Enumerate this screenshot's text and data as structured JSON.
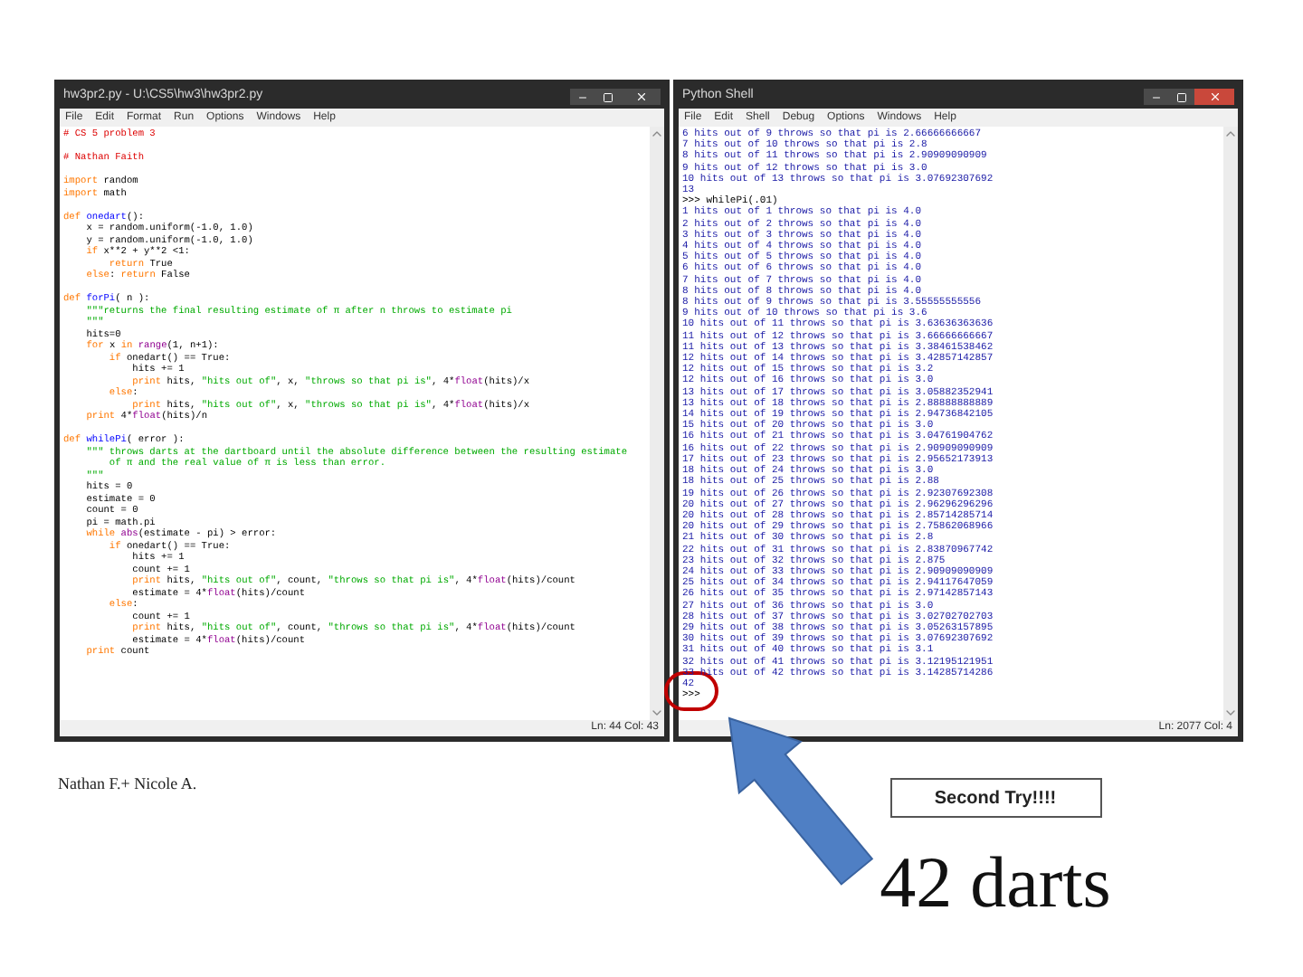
{
  "slide": {
    "editor_window": {
      "title": "hw3pr2.py - U:\\CS5\\hw3\\hw3pr2.py",
      "menu": [
        "File",
        "Edit",
        "Format",
        "Run",
        "Options",
        "Windows",
        "Help"
      ],
      "blocks": [
        {
          "lines": [
            {
              "tokens": [
                {
                  "text": "# CS 5 problem 3",
                  "kind": "comment"
                }
              ]
            }
          ]
        },
        {
          "lines": [
            {
              "tokens": [
                {
                  "text": "# Nathan Faith",
                  "kind": "comment"
                }
              ]
            }
          ]
        },
        {
          "lines": [
            {
              "tokens": [
                {
                  "text": "import",
                  "kind": "keyword"
                },
                {
                  "text": " random",
                  "kind": "plain"
                }
              ]
            },
            {
              "tokens": [
                {
                  "text": "import",
                  "kind": "keyword"
                },
                {
                  "text": " math",
                  "kind": "plain"
                }
              ]
            }
          ]
        },
        {
          "lines": [
            {
              "tokens": [
                {
                  "text": "def ",
                  "kind": "keyword"
                },
                {
                  "text": "onedart",
                  "kind": "defname"
                },
                {
                  "text": "():",
                  "kind": "plain"
                }
              ]
            },
            {
              "tokens": [
                {
                  "text": "    x = random.uniform(-1.0, 1.0)",
                  "kind": "plain"
                }
              ]
            },
            {
              "tokens": [
                {
                  "text": "    y = random.uniform(-1.0, 1.0)",
                  "kind": "plain"
                }
              ]
            },
            {
              "tokens": [
                {
                  "text": "    if",
                  "kind": "keyword"
                },
                {
                  "text": " x**2 + y**2 <1:",
                  "kind": "plain"
                }
              ]
            },
            {
              "tokens": [
                {
                  "text": "        return",
                  "kind": "keyword"
                },
                {
                  "text": " True",
                  "kind": "plain"
                }
              ]
            },
            {
              "tokens": [
                {
                  "text": "    else",
                  "kind": "keyword"
                },
                {
                  "text": ": ",
                  "kind": "plain"
                },
                {
                  "text": "return",
                  "kind": "keyword"
                },
                {
                  "text": " False",
                  "kind": "plain"
                }
              ]
            }
          ]
        },
        {
          "lines": [
            {
              "tokens": [
                {
                  "text": "def ",
                  "kind": "keyword"
                },
                {
                  "text": "forPi",
                  "kind": "defname"
                },
                {
                  "text": "( n ):",
                  "kind": "plain"
                }
              ]
            },
            {
              "tokens": [
                {
                  "text": "    \"\"\"returns the final resulting estimate of π after n throws to estimate pi",
                  "kind": "string"
                }
              ]
            },
            {
              "tokens": [
                {
                  "text": "    \"\"\"",
                  "kind": "string"
                }
              ]
            },
            {
              "tokens": [
                {
                  "text": "    hits=0",
                  "kind": "plain"
                }
              ]
            },
            {
              "tokens": [
                {
                  "text": "    for",
                  "kind": "keyword"
                },
                {
                  "text": " x ",
                  "kind": "plain"
                },
                {
                  "text": "in",
                  "kind": "keyword"
                },
                {
                  "text": " range",
                  "kind": "builtin"
                },
                {
                  "text": "(1, n+1):",
                  "kind": "plain"
                }
              ]
            },
            {
              "tokens": [
                {
                  "text": "        if",
                  "kind": "keyword"
                },
                {
                  "text": " onedart() == True:",
                  "kind": "plain"
                }
              ]
            },
            {
              "tokens": [
                {
                  "text": "            hits += 1",
                  "kind": "plain"
                }
              ]
            },
            {
              "tokens": [
                {
                  "text": "            print",
                  "kind": "keyword"
                },
                {
                  "text": " hits, ",
                  "kind": "plain"
                },
                {
                  "text": "\"hits out of\"",
                  "kind": "string"
                },
                {
                  "text": ", x, ",
                  "kind": "plain"
                },
                {
                  "text": "\"throws so that pi is\"",
                  "kind": "string"
                },
                {
                  "text": ", 4*",
                  "kind": "plain"
                },
                {
                  "text": "float",
                  "kind": "builtin"
                },
                {
                  "text": "(hits)/x",
                  "kind": "plain"
                }
              ]
            },
            {
              "tokens": [
                {
                  "text": "        else",
                  "kind": "keyword"
                },
                {
                  "text": ":",
                  "kind": "plain"
                }
              ]
            },
            {
              "tokens": [
                {
                  "text": "            print",
                  "kind": "keyword"
                },
                {
                  "text": " hits, ",
                  "kind": "plain"
                },
                {
                  "text": "\"hits out of\"",
                  "kind": "string"
                },
                {
                  "text": ", x, ",
                  "kind": "plain"
                },
                {
                  "text": "\"throws so that pi is\"",
                  "kind": "string"
                },
                {
                  "text": ", 4*",
                  "kind": "plain"
                },
                {
                  "text": "float",
                  "kind": "builtin"
                },
                {
                  "text": "(hits)/x",
                  "kind": "plain"
                }
              ]
            },
            {
              "tokens": [
                {
                  "text": "    print",
                  "kind": "keyword"
                },
                {
                  "text": " 4*",
                  "kind": "plain"
                },
                {
                  "text": "float",
                  "kind": "builtin"
                },
                {
                  "text": "(hits)/n",
                  "kind": "plain"
                }
              ]
            }
          ]
        },
        {
          "lines": [
            {
              "tokens": [
                {
                  "text": "def ",
                  "kind": "keyword"
                },
                {
                  "text": "whilePi",
                  "kind": "defname"
                },
                {
                  "text": "( error ):",
                  "kind": "plain"
                }
              ]
            },
            {
              "tokens": [
                {
                  "text": "    \"\"\" throws darts at the dartboard until the absolute difference between the resulting estimate",
                  "kind": "string"
                }
              ]
            },
            {
              "tokens": [
                {
                  "text": "        of π and the real value of π is less than error.",
                  "kind": "string"
                }
              ]
            },
            {
              "tokens": [
                {
                  "text": "    \"\"\"",
                  "kind": "string"
                }
              ]
            },
            {
              "tokens": [
                {
                  "text": "    hits = 0",
                  "kind": "plain"
                }
              ]
            },
            {
              "tokens": [
                {
                  "text": "    estimate = 0",
                  "kind": "plain"
                }
              ]
            },
            {
              "tokens": [
                {
                  "text": "    count = 0",
                  "kind": "plain"
                }
              ]
            },
            {
              "tokens": [
                {
                  "text": "    pi = math.pi",
                  "kind": "plain"
                }
              ]
            },
            {
              "tokens": [
                {
                  "text": "    while",
                  "kind": "keyword"
                },
                {
                  "text": " abs",
                  "kind": "builtin"
                },
                {
                  "text": "(estimate - pi) > error:",
                  "kind": "plain"
                }
              ]
            },
            {
              "tokens": [
                {
                  "text": "        if",
                  "kind": "keyword"
                },
                {
                  "text": " onedart() == True:",
                  "kind": "plain"
                }
              ]
            },
            {
              "tokens": [
                {
                  "text": "            hits += 1",
                  "kind": "plain"
                }
              ]
            },
            {
              "tokens": [
                {
                  "text": "            count += 1",
                  "kind": "plain"
                }
              ]
            },
            {
              "tokens": [
                {
                  "text": "            print",
                  "kind": "keyword"
                },
                {
                  "text": " hits, ",
                  "kind": "plain"
                },
                {
                  "text": "\"hits out of\"",
                  "kind": "string"
                },
                {
                  "text": ", count, ",
                  "kind": "plain"
                },
                {
                  "text": "\"throws so that pi is\"",
                  "kind": "string"
                },
                {
                  "text": ", 4*",
                  "kind": "plain"
                },
                {
                  "text": "float",
                  "kind": "builtin"
                },
                {
                  "text": "(hits)/count",
                  "kind": "plain"
                }
              ]
            },
            {
              "tokens": [
                {
                  "text": "            estimate = 4*",
                  "kind": "plain"
                },
                {
                  "text": "float",
                  "kind": "builtin"
                },
                {
                  "text": "(hits)/count",
                  "kind": "plain"
                }
              ]
            },
            {
              "tokens": [
                {
                  "text": "        else",
                  "kind": "keyword"
                },
                {
                  "text": ":",
                  "kind": "plain"
                }
              ]
            },
            {
              "tokens": [
                {
                  "text": "            count += 1",
                  "kind": "plain"
                }
              ]
            },
            {
              "tokens": [
                {
                  "text": "            print",
                  "kind": "keyword"
                },
                {
                  "text": " hits, ",
                  "kind": "plain"
                },
                {
                  "text": "\"hits out of\"",
                  "kind": "string"
                },
                {
                  "text": ", count, ",
                  "kind": "plain"
                },
                {
                  "text": "\"throws so that pi is\"",
                  "kind": "string"
                },
                {
                  "text": ", 4*",
                  "kind": "plain"
                },
                {
                  "text": "float",
                  "kind": "builtin"
                },
                {
                  "text": "(hits)/count",
                  "kind": "plain"
                }
              ]
            },
            {
              "tokens": [
                {
                  "text": "            estimate = 4*",
                  "kind": "plain"
                },
                {
                  "text": "float",
                  "kind": "builtin"
                },
                {
                  "text": "(hits)/count",
                  "kind": "plain"
                }
              ]
            },
            {
              "tokens": [
                {
                  "text": "    print",
                  "kind": "keyword"
                },
                {
                  "text": " count",
                  "kind": "plain"
                }
              ]
            }
          ]
        }
      ],
      "status": "Ln: 44 Col: 43"
    },
    "shell_window": {
      "title": "Python Shell",
      "menu": [
        "File",
        "Edit",
        "Shell",
        "Debug",
        "Options",
        "Windows",
        "Help"
      ],
      "lines": [
        {
          "text": "6 hits out of 9 throws so that pi is 2.66666666667",
          "kind": "output"
        },
        {
          "text": "7 hits out of 10 throws so that pi is 2.8",
          "kind": "output"
        },
        {
          "text": "8 hits out of 11 throws so that pi is 2.90909090909",
          "kind": "output"
        },
        {
          "text": "9 hits out of 12 throws so that pi is 3.0",
          "kind": "output"
        },
        {
          "text": "10 hits out of 13 throws so that pi is 3.07692307692",
          "kind": "output"
        },
        {
          "text": "13",
          "kind": "output"
        },
        {
          "text": ">>> whilePi(.01)",
          "kind": "input"
        },
        {
          "text": "1 hits out of 1 throws so that pi is 4.0",
          "kind": "output"
        },
        {
          "text": "2 hits out of 2 throws so that pi is 4.0",
          "kind": "output"
        },
        {
          "text": "3 hits out of 3 throws so that pi is 4.0",
          "kind": "output"
        },
        {
          "text": "4 hits out of 4 throws so that pi is 4.0",
          "kind": "output"
        },
        {
          "text": "5 hits out of 5 throws so that pi is 4.0",
          "kind": "output"
        },
        {
          "text": "6 hits out of 6 throws so that pi is 4.0",
          "kind": "output"
        },
        {
          "text": "7 hits out of 7 throws so that pi is 4.0",
          "kind": "output"
        },
        {
          "text": "8 hits out of 8 throws so that pi is 4.0",
          "kind": "output"
        },
        {
          "text": "8 hits out of 9 throws so that pi is 3.55555555556",
          "kind": "output"
        },
        {
          "text": "9 hits out of 10 throws so that pi is 3.6",
          "kind": "output"
        },
        {
          "text": "10 hits out of 11 throws so that pi is 3.63636363636",
          "kind": "output"
        },
        {
          "text": "11 hits out of 12 throws so that pi is 3.66666666667",
          "kind": "output"
        },
        {
          "text": "11 hits out of 13 throws so that pi is 3.38461538462",
          "kind": "output"
        },
        {
          "text": "12 hits out of 14 throws so that pi is 3.42857142857",
          "kind": "output"
        },
        {
          "text": "12 hits out of 15 throws so that pi is 3.2",
          "kind": "output"
        },
        {
          "text": "12 hits out of 16 throws so that pi is 3.0",
          "kind": "output"
        },
        {
          "text": "13 hits out of 17 throws so that pi is 3.05882352941",
          "kind": "output"
        },
        {
          "text": "13 hits out of 18 throws so that pi is 2.88888888889",
          "kind": "output"
        },
        {
          "text": "14 hits out of 19 throws so that pi is 2.94736842105",
          "kind": "output"
        },
        {
          "text": "15 hits out of 20 throws so that pi is 3.0",
          "kind": "output"
        },
        {
          "text": "16 hits out of 21 throws so that pi is 3.04761904762",
          "kind": "output"
        },
        {
          "text": "16 hits out of 22 throws so that pi is 2.90909090909",
          "kind": "output"
        },
        {
          "text": "17 hits out of 23 throws so that pi is 2.95652173913",
          "kind": "output"
        },
        {
          "text": "18 hits out of 24 throws so that pi is 3.0",
          "kind": "output"
        },
        {
          "text": "18 hits out of 25 throws so that pi is 2.88",
          "kind": "output"
        },
        {
          "text": "19 hits out of 26 throws so that pi is 2.92307692308",
          "kind": "output"
        },
        {
          "text": "20 hits out of 27 throws so that pi is 2.96296296296",
          "kind": "output"
        },
        {
          "text": "20 hits out of 28 throws so that pi is 2.85714285714",
          "kind": "output"
        },
        {
          "text": "20 hits out of 29 throws so that pi is 2.75862068966",
          "kind": "output"
        },
        {
          "text": "21 hits out of 30 throws so that pi is 2.8",
          "kind": "output"
        },
        {
          "text": "22 hits out of 31 throws so that pi is 2.83870967742",
          "kind": "output"
        },
        {
          "text": "23 hits out of 32 throws so that pi is 2.875",
          "kind": "output"
        },
        {
          "text": "24 hits out of 33 throws so that pi is 2.90909090909",
          "kind": "output"
        },
        {
          "text": "25 hits out of 34 throws so that pi is 2.94117647059",
          "kind": "output"
        },
        {
          "text": "26 hits out of 35 throws so that pi is 2.97142857143",
          "kind": "output"
        },
        {
          "text": "27 hits out of 36 throws so that pi is 3.0",
          "kind": "output"
        },
        {
          "text": "28 hits out of 37 throws so that pi is 3.02702702703",
          "kind": "output"
        },
        {
          "text": "29 hits out of 38 throws so that pi is 3.05263157895",
          "kind": "output"
        },
        {
          "text": "30 hits out of 39 throws so that pi is 3.07692307692",
          "kind": "output"
        },
        {
          "text": "31 hits out of 40 throws so that pi is 3.1",
          "kind": "output"
        },
        {
          "text": "32 hits out of 41 throws so that pi is 3.12195121951",
          "kind": "output"
        },
        {
          "text": "33 hits out of 42 throws so that pi is 3.14285714286",
          "kind": "output"
        },
        {
          "text": "42",
          "kind": "output"
        },
        {
          "text": ">>>",
          "kind": "input"
        }
      ],
      "status": "Ln: 2077 Col: 4"
    },
    "caption": "Nathan F.+ Nicole A.",
    "callout": "Second Try!!!!",
    "result": "42 darts"
  }
}
